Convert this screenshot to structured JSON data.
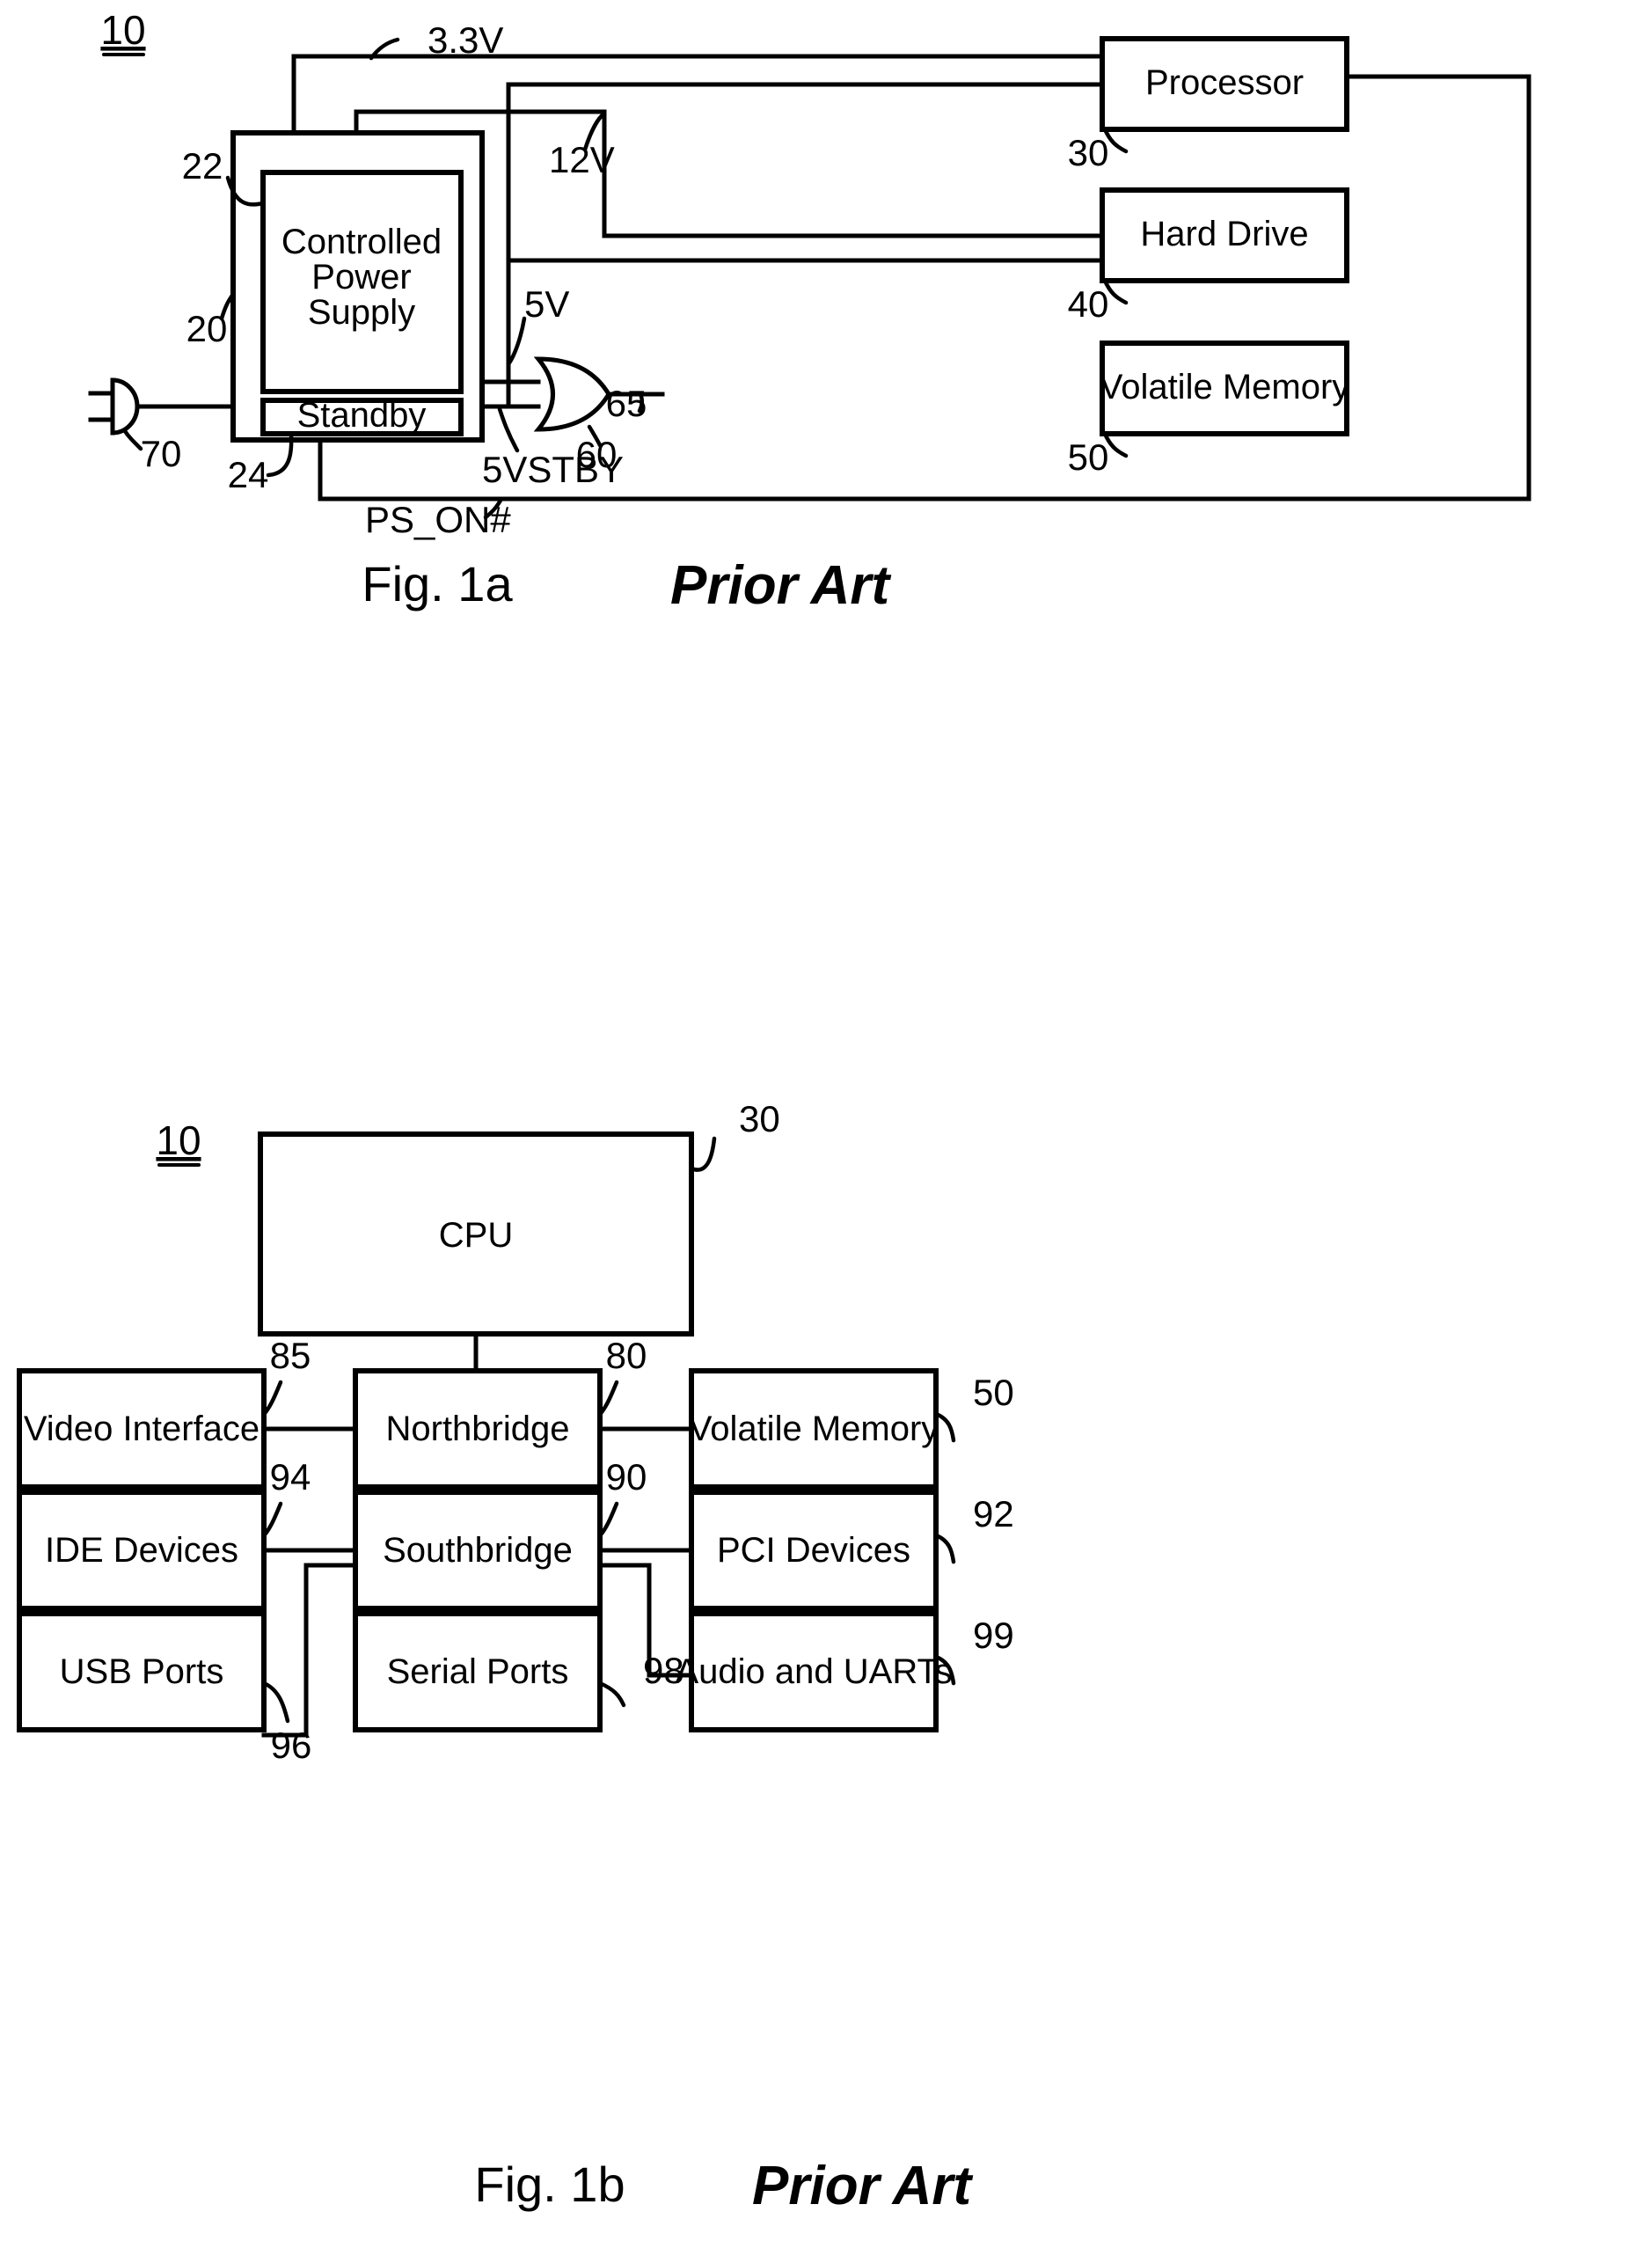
{
  "document": {
    "type": "patent-figure-sheet",
    "figures": [
      {
        "id": "fig-1a",
        "caption": "Fig. 1a",
        "annotation": "Prior Art",
        "system_ref": "10",
        "blocks": [
          {
            "key": "power_supply_outer",
            "label": "",
            "ref": "20"
          },
          {
            "key": "power_supply_inner",
            "label": "Controlled Power Supply",
            "line1": "Controlled",
            "line2": "Power",
            "line3": "Supply",
            "ref": "22"
          },
          {
            "key": "standby",
            "label": "Standby",
            "ref": "24"
          },
          {
            "key": "processor",
            "label": "Processor",
            "ref": "30"
          },
          {
            "key": "hard_drive",
            "label": "Hard Drive",
            "ref": "40"
          },
          {
            "key": "volatile_memory",
            "label": "Volatile Memory",
            "ref": "50"
          },
          {
            "key": "or_gate",
            "label": "",
            "ref": "60"
          },
          {
            "key": "or_gate_output",
            "label": "",
            "ref": "65"
          },
          {
            "key": "ac_plug",
            "label": "",
            "ref": "70"
          }
        ],
        "signals": [
          {
            "key": "rail_3v3",
            "label": "3.3V"
          },
          {
            "key": "rail_12v",
            "label": "12V"
          },
          {
            "key": "rail_5v",
            "label": "5V"
          },
          {
            "key": "rail_5vstby",
            "label": "5VSTBY"
          },
          {
            "key": "ps_on",
            "label": "PS_ON#"
          }
        ]
      },
      {
        "id": "fig-1b",
        "caption": "Fig. 1b",
        "annotation": "Prior Art",
        "system_ref": "10",
        "blocks": [
          {
            "key": "cpu",
            "label": "CPU",
            "ref": "30"
          },
          {
            "key": "video_interface",
            "label": "Video Interface",
            "ref": "85"
          },
          {
            "key": "northbridge",
            "label": "Northbridge",
            "ref": "80"
          },
          {
            "key": "volatile_memory",
            "label": "Volatile Memory",
            "ref": "50"
          },
          {
            "key": "ide_devices",
            "label": "IDE Devices",
            "ref": "94"
          },
          {
            "key": "southbridge",
            "label": "Southbridge",
            "ref": "90"
          },
          {
            "key": "pci_devices",
            "label": "PCI Devices",
            "ref": "92"
          },
          {
            "key": "usb_ports",
            "label": "USB Ports",
            "ref": "96"
          },
          {
            "key": "serial_ports",
            "label": "Serial Ports",
            "ref": "98"
          },
          {
            "key": "audio_uarts",
            "label": "Audio and UARTs",
            "ref": "99"
          }
        ]
      }
    ]
  },
  "colors": {
    "ink": "#000000",
    "paper": "#ffffff"
  }
}
